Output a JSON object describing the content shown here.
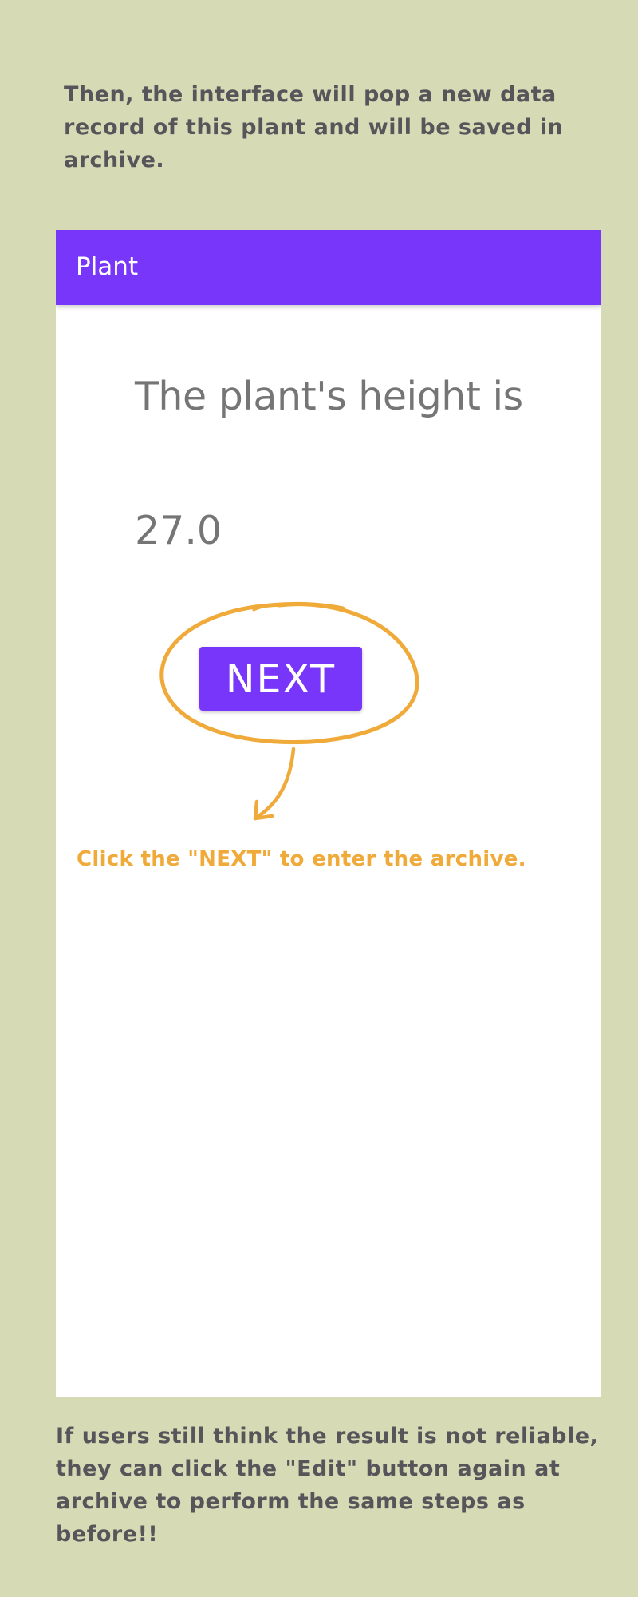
{
  "intro": {
    "text": "Then, the interface will pop a new data record of this plant and will be saved in archive."
  },
  "app_bar": {
    "title": "Plant"
  },
  "result": {
    "label": "The plant's height is",
    "value": "27.0"
  },
  "next_button": {
    "label": "NEXT"
  },
  "annotation": {
    "hint": "Click the \"NEXT\" to enter the archive."
  },
  "outro": {
    "text": "If users still think the result is not reliable, they can click the \"Edit\" button again at archive  to perform the same steps as before!!"
  },
  "colors": {
    "page_background": "#d6dbb6",
    "app_bar": "#7836fb",
    "button": "#7836fb",
    "annotation": "#f0aa3a",
    "body_text": "#58555a",
    "value_text": "#757575"
  },
  "icons": {
    "annotation_circle": "hand-drawn-circle-icon",
    "annotation_arrow": "curved-arrow-icon"
  }
}
